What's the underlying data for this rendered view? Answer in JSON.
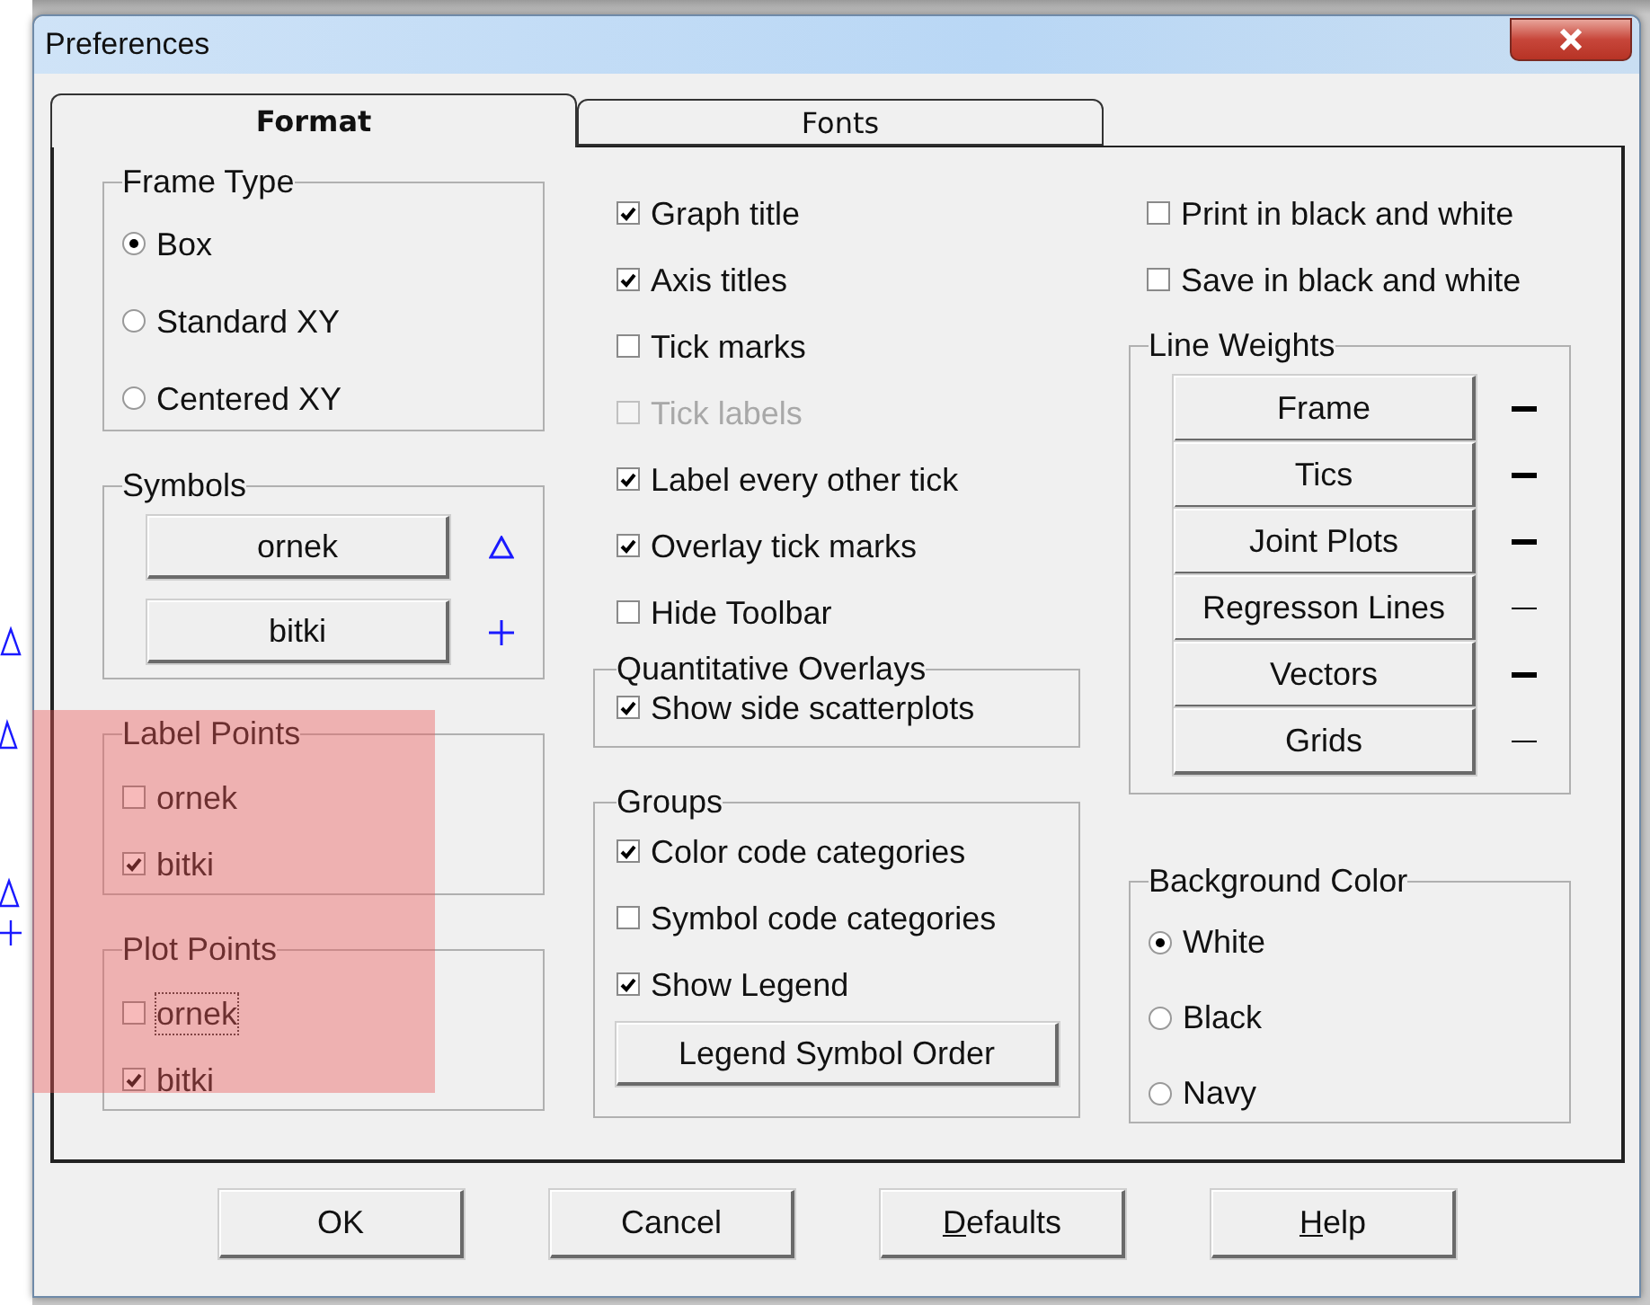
{
  "window": {
    "title": "Preferences"
  },
  "tabs": [
    {
      "label": "Format",
      "selected": true
    },
    {
      "label": "Fonts",
      "selected": false
    }
  ],
  "frame_type": {
    "title": "Frame Type",
    "options": [
      {
        "label": "Box",
        "selected": true
      },
      {
        "label": "Standard XY",
        "selected": false
      },
      {
        "label": "Centered XY",
        "selected": false
      }
    ]
  },
  "symbols": {
    "title": "Symbols",
    "items": [
      {
        "label": "ornek",
        "kind": "triangle"
      },
      {
        "label": "bitki",
        "kind": "plus"
      }
    ]
  },
  "label_points": {
    "title": "Label Points",
    "items": [
      {
        "label": "ornek",
        "checked": false,
        "focused": false
      },
      {
        "label": "bitki",
        "checked": true,
        "focused": false
      }
    ]
  },
  "plot_points": {
    "title": "Plot Points",
    "items": [
      {
        "label": "ornek",
        "checked": false,
        "focused": true
      },
      {
        "label": "bitki",
        "checked": true,
        "focused": false
      }
    ]
  },
  "options": [
    {
      "label": "Graph title",
      "checked": true,
      "disabled": false
    },
    {
      "label": "Axis titles",
      "checked": true,
      "disabled": false
    },
    {
      "label": "Tick marks",
      "checked": false,
      "disabled": false
    },
    {
      "label": "Tick labels",
      "checked": false,
      "disabled": true
    },
    {
      "label": "Label every other tick",
      "checked": true,
      "disabled": false
    },
    {
      "label": "Overlay tick marks",
      "checked": true,
      "disabled": false
    },
    {
      "label": "Hide Toolbar",
      "checked": false,
      "disabled": false
    }
  ],
  "quantitative_overlays": {
    "title": "Quantitative Overlays",
    "items": [
      {
        "label": "Show side scatterplots",
        "checked": true,
        "focused": false
      }
    ]
  },
  "groups": {
    "title": "Groups",
    "items": [
      {
        "label": "Color code categories",
        "checked": true,
        "focused": false
      },
      {
        "label": "Symbol code categories",
        "checked": false,
        "focused": false
      },
      {
        "label": "Show Legend",
        "checked": true,
        "focused": false
      }
    ],
    "button": "Legend Symbol Order"
  },
  "output_options": [
    {
      "label": "Print in black and white",
      "checked": false,
      "disabled": false
    },
    {
      "label": "Save in black and white",
      "checked": false,
      "disabled": false
    }
  ],
  "line_weights": {
    "title": "Line Weights",
    "items": [
      {
        "label": "Frame",
        "kind": "thick"
      },
      {
        "label": "Tics",
        "kind": "thick"
      },
      {
        "label": "Joint Plots",
        "kind": "thick"
      },
      {
        "label": "Regresson Lines",
        "kind": "thin"
      },
      {
        "label": "Vectors",
        "kind": "thick"
      },
      {
        "label": "Grids",
        "kind": "thin"
      }
    ]
  },
  "background_color": {
    "title": "Background Color",
    "options": [
      {
        "label": "White",
        "selected": true
      },
      {
        "label": "Black",
        "selected": false
      },
      {
        "label": "Navy",
        "selected": false
      }
    ]
  },
  "buttons": [
    {
      "label": "OK",
      "underline_first": false
    },
    {
      "label": "Cancel",
      "underline_first": false
    },
    {
      "label": "Defaults",
      "underline_first": true
    },
    {
      "label": "Help",
      "underline_first": true
    }
  ],
  "highlight_overlay": true
}
